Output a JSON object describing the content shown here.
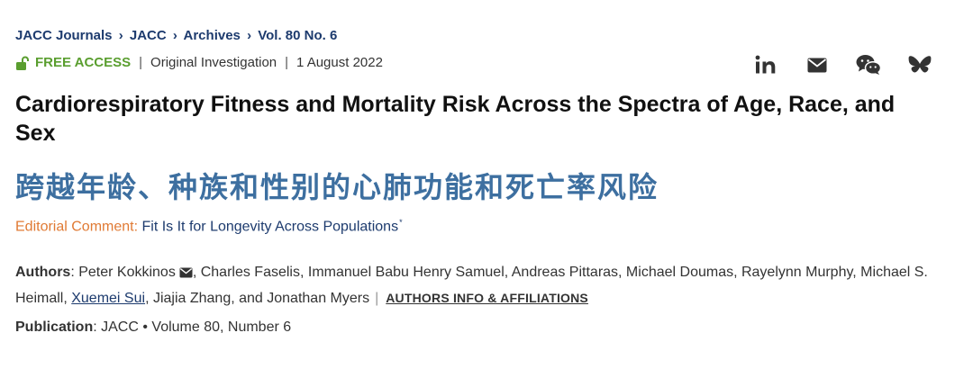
{
  "breadcrumb": {
    "items": [
      "JACC Journals",
      "JACC",
      "Archives",
      "Vol. 80 No. 6"
    ],
    "separator": "›"
  },
  "article_meta": {
    "access": "FREE ACCESS",
    "type": "Original Investigation",
    "date": "1 August 2022",
    "divider": "|"
  },
  "share": {
    "icons": [
      "linkedin-icon",
      "email-icon",
      "wechat-icon",
      "bluesky-icon"
    ],
    "linkedin_text": "in"
  },
  "title": "Cardiorespiratory Fitness and Mortality Risk Across the Spectra of Age, Race, and Sex",
  "translated_title": "跨越年龄、种族和性别的心肺功能和死亡率风险",
  "editorial": {
    "label": "Editorial Comment:",
    "link": "Fit Is It for Longevity Across Populations",
    "marker": "*"
  },
  "authors": {
    "label": "Authors",
    "colon": ": ",
    "first": "Peter Kokkinos",
    "middle": ", Charles Faselis, Immanuel Babu Henry Samuel, Andreas Pittaras, Michael Doumas, Rayelynn Murphy, Michael S. Heimall, ",
    "linked": "Xuemei Sui",
    "last": ", Jiajia Zhang, and Jonathan Myers",
    "divider": "|",
    "affiliations": "AUTHORS INFO & AFFILIATIONS"
  },
  "publication": {
    "label": "Publication",
    "colon": ": ",
    "value": "JACC • Volume 80, Number 6"
  },
  "colors": {
    "navy": "#1d3b6e",
    "free_access_green": "#5a9e2f",
    "editorial_orange": "#e07a34",
    "translated_title_blue": "#3d6fa0"
  }
}
